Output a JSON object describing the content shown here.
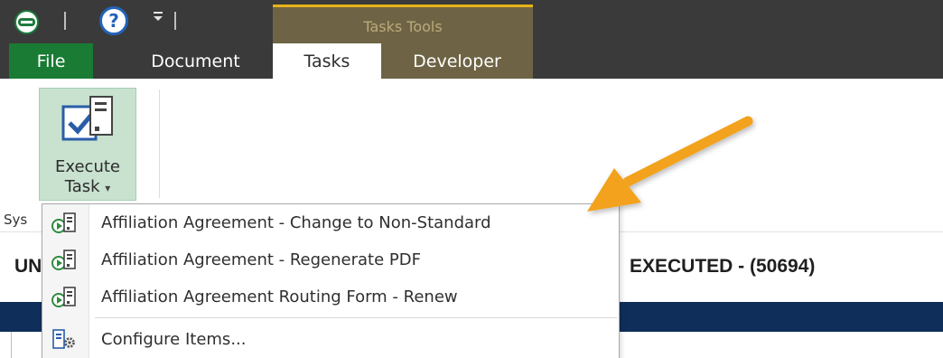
{
  "qat": {
    "logo_icon": "onbase-logo-icon",
    "help_icon": "help-icon",
    "dropdown_glyph": "≡"
  },
  "contextual_group": {
    "label": "Tasks Tools",
    "accent": "#e8b21a"
  },
  "tabs": [
    {
      "label": "File"
    },
    {
      "label": "Document"
    },
    {
      "label": "Tasks"
    },
    {
      "label": "Developer"
    }
  ],
  "ribbon": {
    "execute_line1": "Execute",
    "execute_line2": "Task",
    "execute_caret": "▾",
    "group_label_clipped": "Sys"
  },
  "document": {
    "title_left": "UN",
    "title_right": "EXECUTED - (50694)"
  },
  "menu": {
    "items": [
      {
        "label": "Affiliation Agreement - Change to Non-Standard",
        "icon": "task-execute-icon"
      },
      {
        "label": "Affiliation Agreement - Regenerate PDF",
        "icon": "task-execute-icon"
      },
      {
        "label": "Affiliation Agreement Routing Form - Renew",
        "icon": "task-execute-icon"
      },
      {
        "label": "Configure Items...",
        "icon": "configure-gear-icon"
      }
    ]
  },
  "colors": {
    "file_tab": "#1a7b34",
    "contextual": "#6e6445",
    "navy_bar": "#0f2f5a",
    "arrow": "#f2a21d"
  }
}
